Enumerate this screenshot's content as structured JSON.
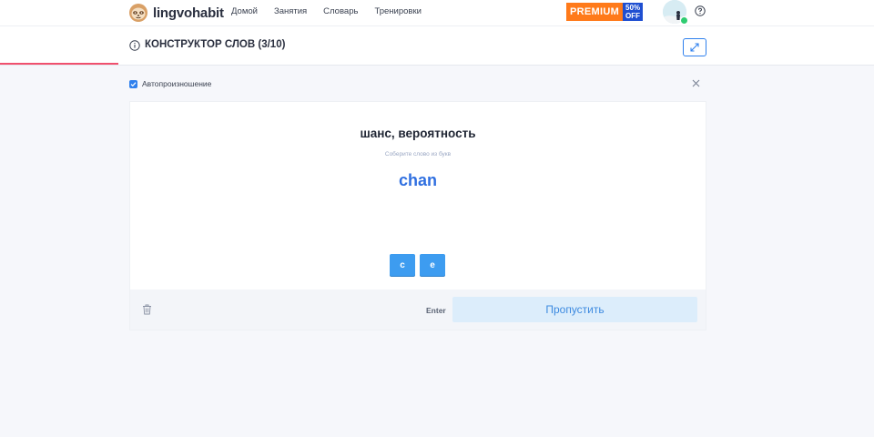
{
  "app": {
    "brand": "lingvohabit"
  },
  "nav": {
    "items": [
      "Домой",
      "Занятия",
      "Словарь",
      "Тренировки"
    ]
  },
  "promo": {
    "label": "PREMIUM",
    "discount_top": "50%",
    "discount_bottom": "OFF"
  },
  "icons": {
    "logo": "sloth-mascot-icon",
    "help": "question-circle-icon",
    "info": "info-circle-icon",
    "expand": "expand-arrows-icon",
    "check": "checkmark-icon",
    "close": "close-icon",
    "trash": "trash-icon"
  },
  "lesson": {
    "title": "КОНСТРУКТОР СЛОВ (3/10)",
    "progress_fraction": 0.135
  },
  "settings": {
    "auto_pronounce_label": "Автопроизношение",
    "auto_pronounce_checked": true
  },
  "exercise": {
    "prompt_word": "шанс, вероятность",
    "hint": "Соберите слово из букв",
    "answer_so_far": "chan",
    "letters": [
      "c",
      "e"
    ]
  },
  "footer": {
    "enter_label": "Enter",
    "skip_label": "Пропустить"
  },
  "colors": {
    "accent": "#2f80ed",
    "progress": "#f0506e",
    "promo_orange": "#ff7a1a",
    "promo_blue": "#1f4fd1"
  }
}
